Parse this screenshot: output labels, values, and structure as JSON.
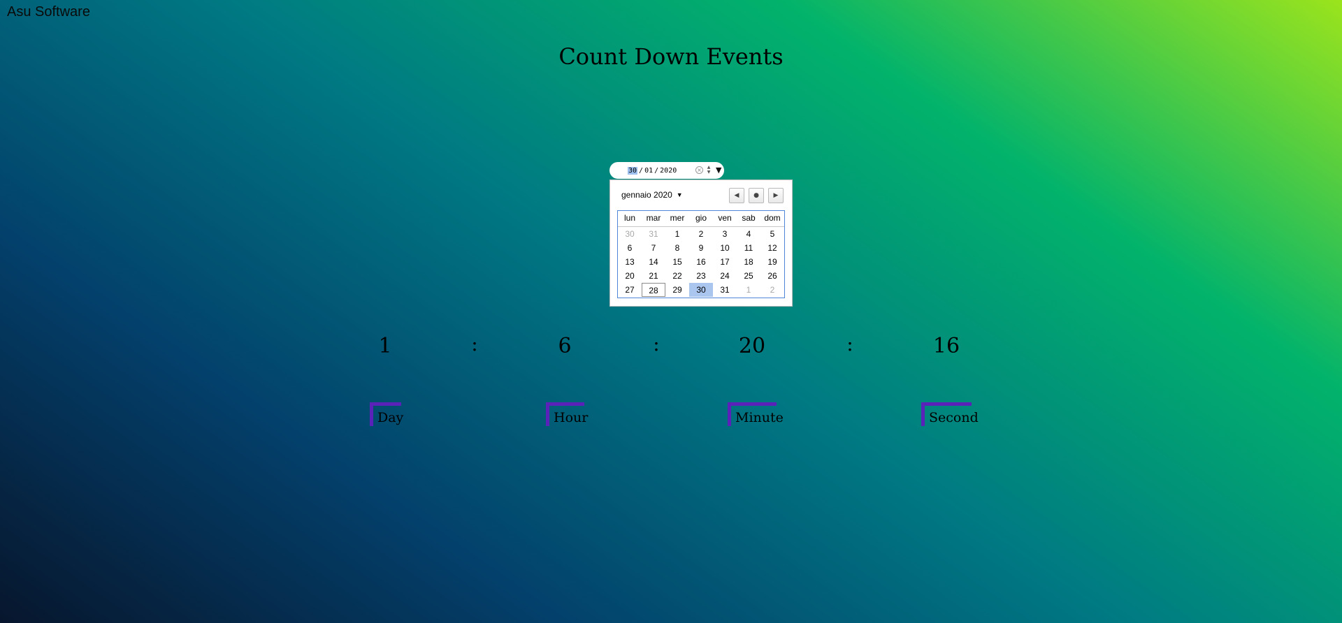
{
  "brand": "Asu Software",
  "title": "Count Down Events",
  "date_input": {
    "day": "30",
    "month": "01",
    "year": "2020",
    "separator": "/"
  },
  "calendar": {
    "month_label": "gennaio 2020",
    "weekdays": [
      "lun",
      "mar",
      "mer",
      "gio",
      "ven",
      "sab",
      "dom"
    ],
    "weeks": [
      [
        "30",
        "31",
        "1",
        "2",
        "3",
        "4",
        "5"
      ],
      [
        "6",
        "7",
        "8",
        "9",
        "10",
        "11",
        "12"
      ],
      [
        "13",
        "14",
        "15",
        "16",
        "17",
        "18",
        "19"
      ],
      [
        "20",
        "21",
        "22",
        "23",
        "24",
        "25",
        "26"
      ],
      [
        "27",
        "28",
        "29",
        "30",
        "31",
        "1",
        "2"
      ]
    ],
    "today": "28",
    "selected": "30"
  },
  "countdown": {
    "days": "1",
    "hours": "6",
    "minutes": "20",
    "seconds": "16",
    "separator": ":",
    "labels": {
      "day": "Day",
      "hour": "Hour",
      "minute": "Minute",
      "second": "Second"
    }
  },
  "colors": {
    "label_accent": "#5a22b8",
    "selected_day": "#aac5ee",
    "calendar_border": "#4f86d9"
  }
}
